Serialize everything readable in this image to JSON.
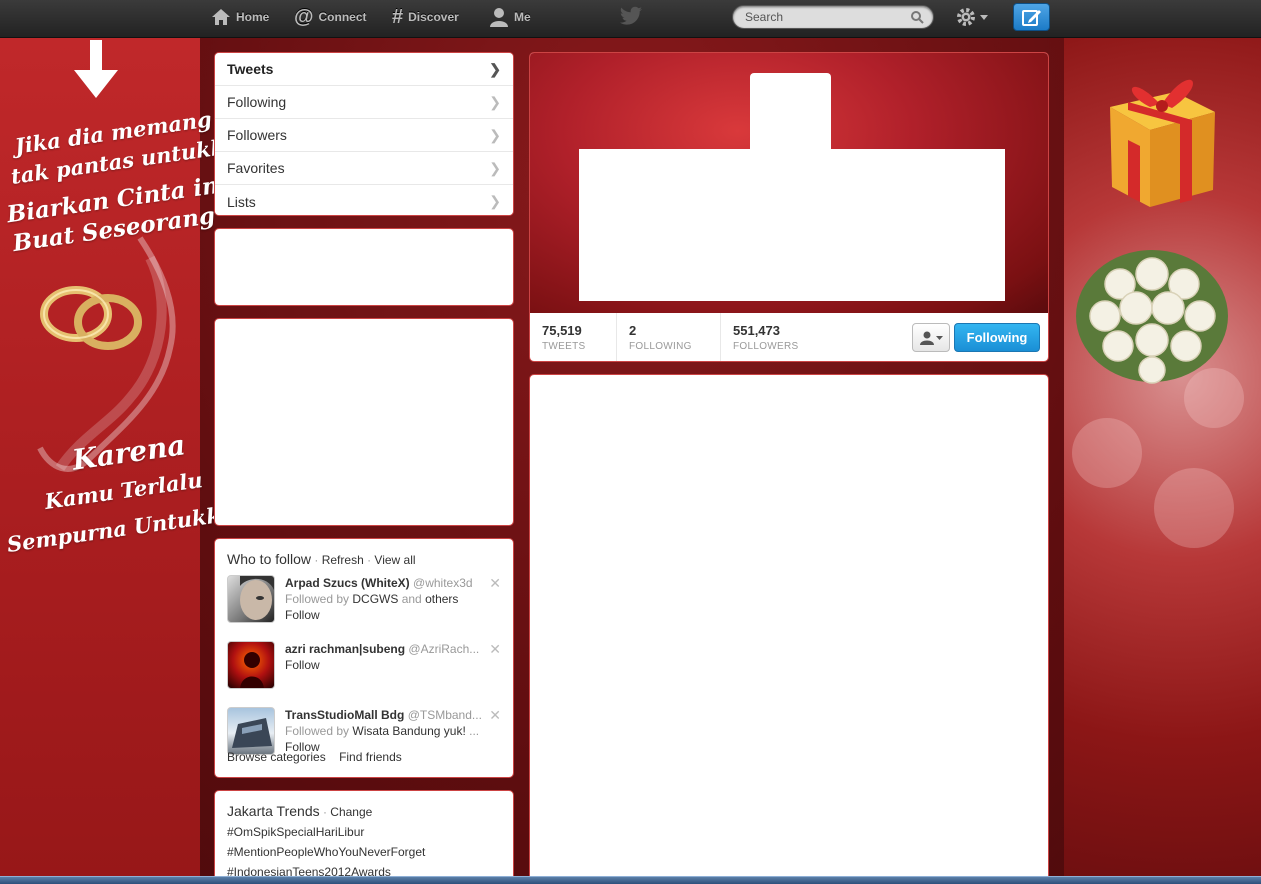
{
  "topbar": {
    "home": "Home",
    "connect": "Connect",
    "discover": "Discover",
    "me": "Me",
    "search_placeholder": "Search"
  },
  "sidebar_text": {
    "line1": "Jika dia memang",
    "line2": "tak pantas untukku",
    "line3": "Biarkan Cinta ini",
    "line4": "Buat Seseorang",
    "line5": "Karena",
    "line6": "Kamu Terlalu",
    "line7": "Sempurna Untukku"
  },
  "nav": {
    "items": [
      {
        "label": "Tweets"
      },
      {
        "label": "Following"
      },
      {
        "label": "Followers"
      },
      {
        "label": "Favorites"
      },
      {
        "label": "Lists"
      }
    ]
  },
  "profile": {
    "stats": [
      {
        "num": "75,519",
        "label": "TWEETS"
      },
      {
        "num": "2",
        "label": "FOLLOWING"
      },
      {
        "num": "551,473",
        "label": "FOLLOWERS"
      }
    ],
    "follow_button": "Following"
  },
  "who_to_follow": {
    "title": "Who to follow",
    "sep1": " · ",
    "refresh": "Refresh",
    "sep2": " · ",
    "view_all": "View all",
    "suggestions": [
      {
        "name": "Arpad Szucs (WhiteX)",
        "handle": "@whitex3d",
        "followed_by_prefix": "Followed by ",
        "followed_by": "DCGWS",
        "and": " and ",
        "others": "others",
        "follow": "Follow"
      },
      {
        "name": "azri rachman|subeng",
        "handle": "@AzriRach...",
        "follow": "Follow"
      },
      {
        "name": "TransStudioMall Bdg",
        "handle": "@TSMband...",
        "followed_by_prefix": "Followed by ",
        "followed_by": "Wisata Bandung yuk!",
        "ellipsis": " ...",
        "follow": "Follow"
      }
    ],
    "browse_categories": "Browse categories",
    "find_friends": "Find friends"
  },
  "trends": {
    "title": "Jakarta Trends",
    "sep": " · ",
    "change": "Change",
    "items": [
      "#OmSpikSpecialHariLibur",
      "#MentionPeopleWhoYouNeverForget",
      "#IndonesianTeens2012Awards"
    ]
  },
  "colors": {
    "accent": "#1a8fd6",
    "background": "#8a1a1c"
  },
  "icons": [
    "home-icon",
    "connect-icon",
    "discover-icon",
    "me-icon",
    "twitter-bird-icon",
    "search-icon",
    "gear-icon",
    "compose-icon",
    "chevron-right-icon",
    "user-dropdown-icon",
    "close-icon"
  ]
}
